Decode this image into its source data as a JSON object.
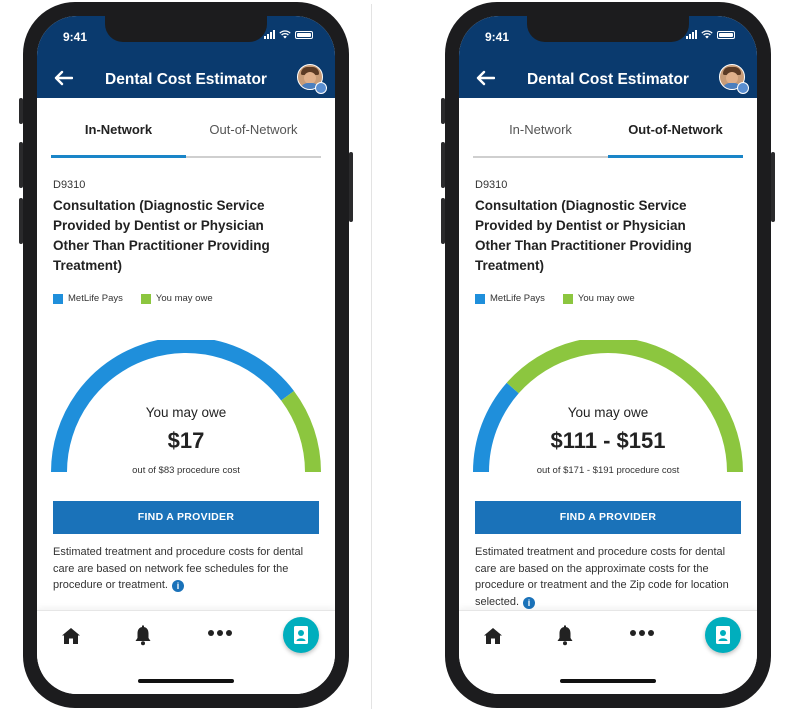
{
  "phones": [
    {
      "status": {
        "time": "9:41"
      },
      "header": {
        "title": "Dental Cost Estimator"
      },
      "tabs": [
        {
          "label": "In-Network",
          "active": true
        },
        {
          "label": "Out-of-Network",
          "active": false
        }
      ],
      "procedure": {
        "code": "D9310",
        "title": "Consultation (Diagnostic Service Provided by Dentist or Physician Other Than Practitioner Providing Treatment)"
      },
      "legend": {
        "pays_label": "MetLife Pays",
        "owe_label": "You may owe"
      },
      "gauge": {
        "you_may_owe_fraction": 0.205
      },
      "estimate": {
        "label": "You may owe",
        "amount": "$17",
        "subtext": "out of $83 procedure cost"
      },
      "button": {
        "label": "FIND A PROVIDER"
      },
      "disclaimer": "Estimated treatment and procedure costs for dental care are based on network fee schedules for the procedure or treatment.",
      "nav": {
        "items": [
          "home-icon",
          "bell-icon",
          "more-icon",
          "profile-card-icon"
        ]
      }
    },
    {
      "status": {
        "time": "9:41"
      },
      "header": {
        "title": "Dental Cost Estimator"
      },
      "tabs": [
        {
          "label": "In-Network",
          "active": false
        },
        {
          "label": "Out-of-Network",
          "active": true
        }
      ],
      "procedure": {
        "code": "D9310",
        "title": "Consultation (Diagnostic Service Provided by Dentist or Physician Other Than Practitioner Providing Treatment)"
      },
      "legend": {
        "pays_label": "MetLife Pays",
        "owe_label": "You may owe"
      },
      "gauge": {
        "you_may_owe_fraction": 0.77
      },
      "estimate": {
        "label": "You may owe",
        "amount": "$111 - $151",
        "subtext": "out of $171 - $191 procedure cost"
      },
      "button": {
        "label": "FIND A PROVIDER"
      },
      "disclaimer": "Estimated treatment and procedure costs for dental care are based on the approximate costs for the procedure or treatment and the Zip code for location selected.",
      "nav": {
        "items": [
          "home-icon",
          "bell-icon",
          "more-icon",
          "profile-card-icon"
        ]
      }
    }
  ],
  "colors": {
    "header_bg": "#0a3a6e",
    "metlife_pays": "#1f8fdb",
    "you_may_owe": "#8cc63f",
    "button_bg": "#1a72b9",
    "tab_underline": "#1a85c8",
    "profile_fab": "#00aebd"
  }
}
